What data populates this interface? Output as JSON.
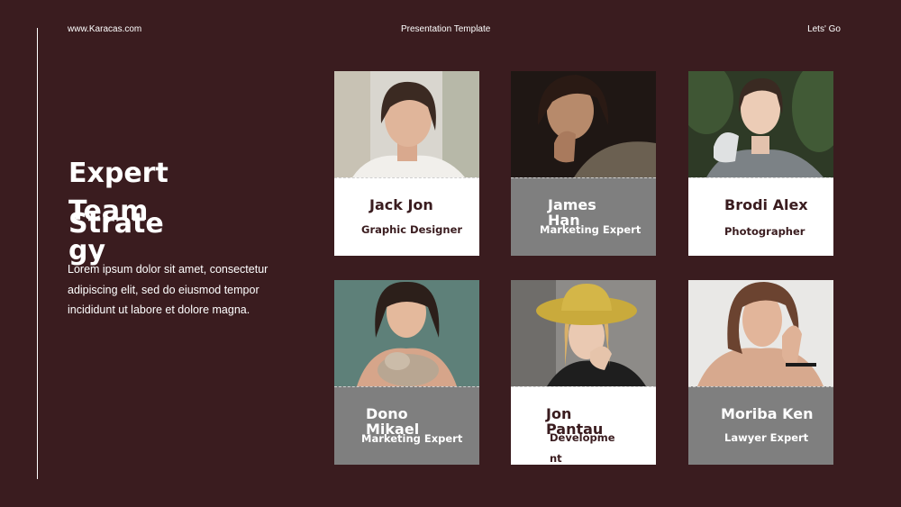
{
  "header": {
    "website": "www.Karacas.com",
    "center_title": "Presentation Template",
    "right_link": "Lets' Go"
  },
  "heading": {
    "line1": "Expert",
    "line2": "Team",
    "line3": "Strategy"
  },
  "description": "Lorem ipsum dolor sit amet, consectetur adipiscing elit, sed do eiusmod tempor incididunt ut labore et dolore magna.",
  "team": [
    {
      "name": "Jack Jon",
      "role": "Graphic Designer"
    },
    {
      "name": "James Han",
      "role": "Marketing Expert"
    },
    {
      "name": "Brodi Alex",
      "role": "Photographer"
    },
    {
      "name": "Dono Mikael",
      "role": "Marketing Expert"
    },
    {
      "name": "Jon Pantau",
      "role": "Development"
    },
    {
      "name": "Moriba Ken",
      "role": "Lawyer Expert"
    }
  ],
  "colors": {
    "background": "#3a1c1f",
    "card_white": "#ffffff",
    "card_gray": "#7f7f7f",
    "text_dark": "#3a1c1f"
  }
}
